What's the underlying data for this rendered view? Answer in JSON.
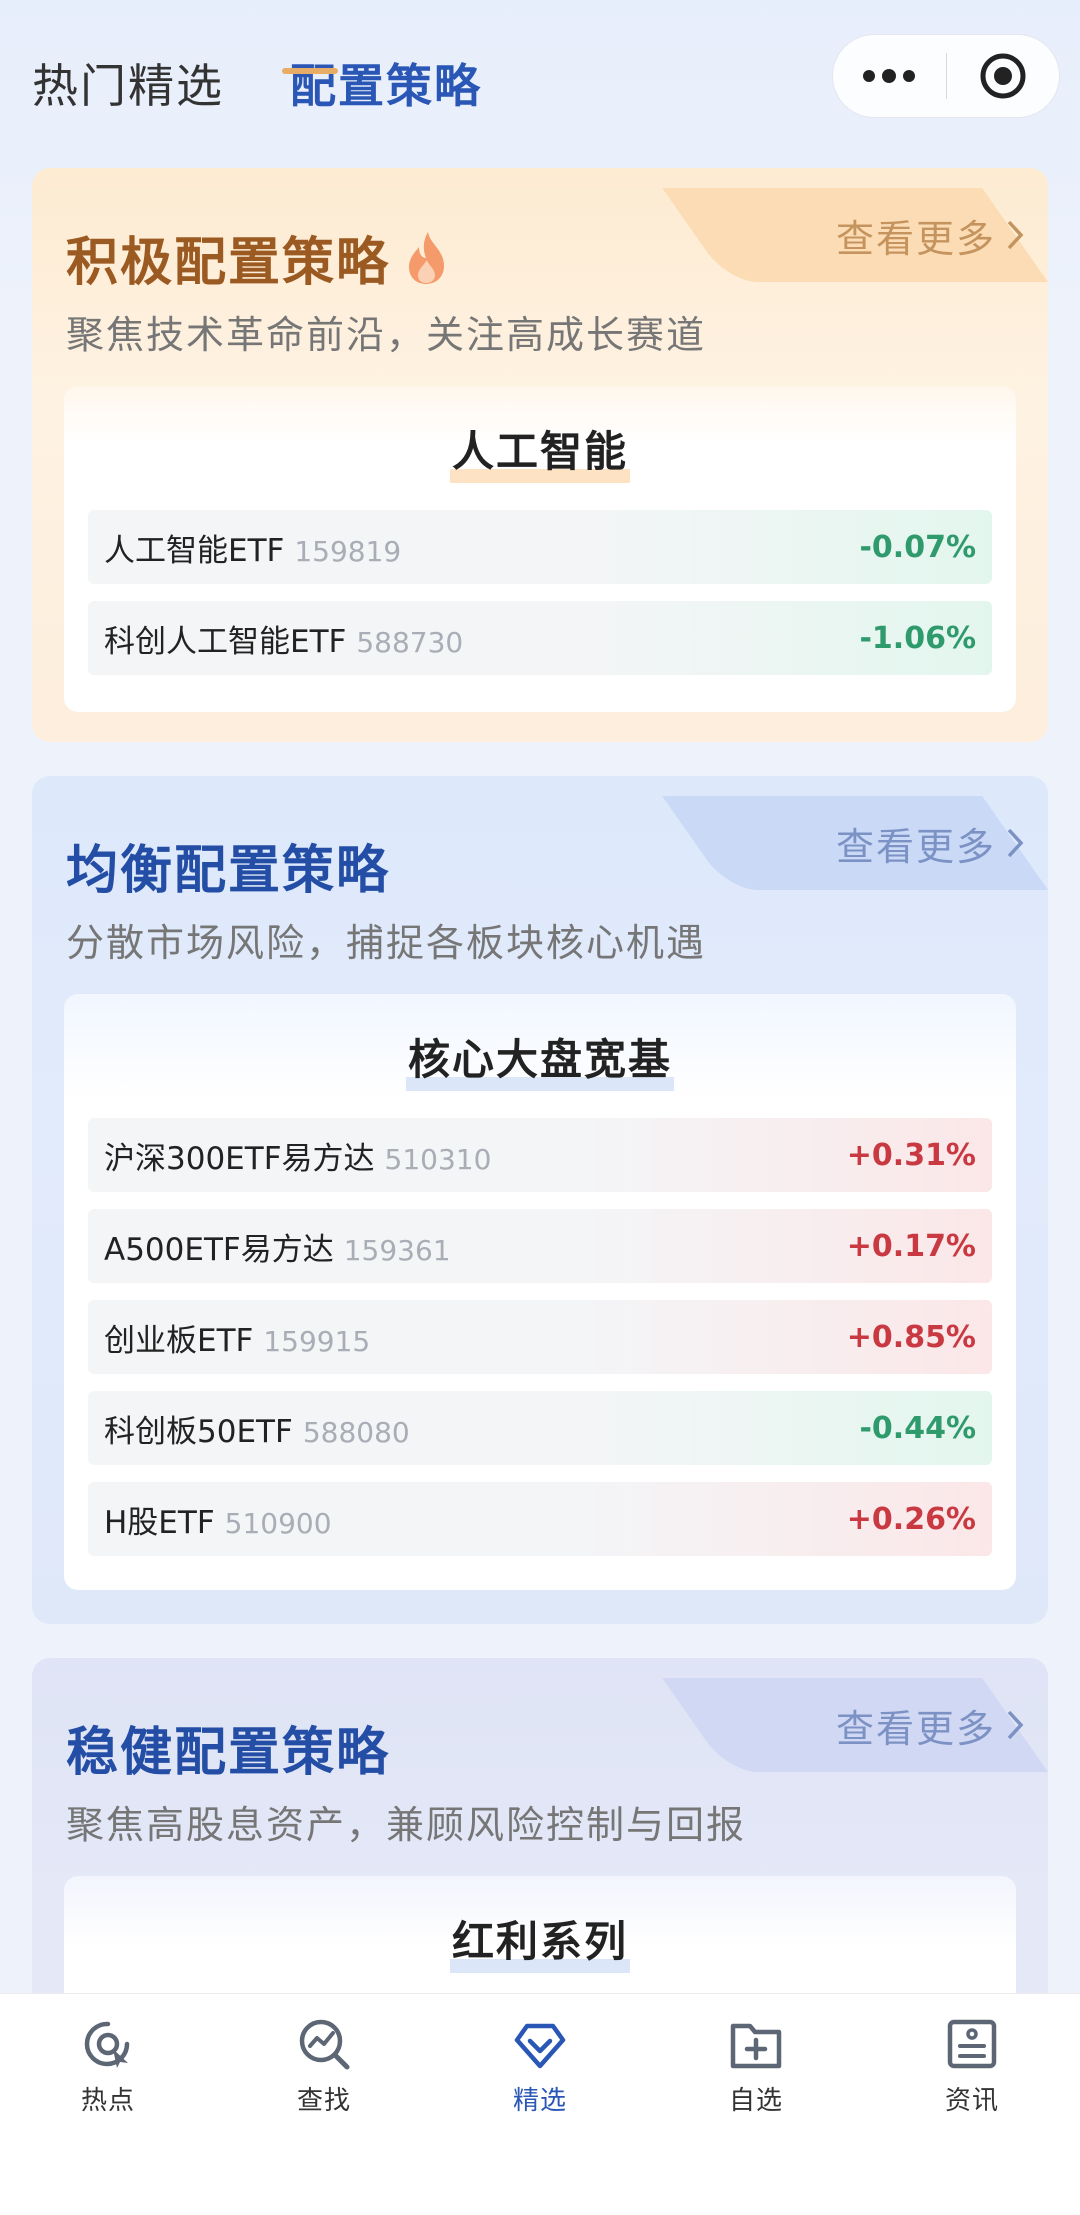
{
  "header": {
    "tabs": [
      {
        "label": "热门精选",
        "active": false
      },
      {
        "label": "配置策略",
        "active": true
      }
    ],
    "capsule": {
      "more_icon": "more-dots-icon",
      "close_icon": "mini-program-close-icon"
    }
  },
  "strategies": [
    {
      "title": "积极配置策略",
      "subtitle": "聚焦技术革命前沿，关注高成长赛道",
      "more_label": "查看更多",
      "title_icon": "fire-icon",
      "group_title": "人工智能",
      "funds": [
        {
          "name": "人工智能ETF",
          "code": "159819",
          "change": "-0.07%",
          "direction": "down"
        },
        {
          "name": "科创人工智能ETF",
          "code": "588730",
          "change": "-1.06%",
          "direction": "down"
        }
      ]
    },
    {
      "title": "均衡配置策略",
      "subtitle": "分散市场风险，捕捉各板块核心机遇",
      "more_label": "查看更多",
      "group_title": "核心大盘宽基",
      "funds": [
        {
          "name": "沪深300ETF易方达",
          "code": "510310",
          "change": "+0.31%",
          "direction": "up"
        },
        {
          "name": "A500ETF易方达",
          "code": "159361",
          "change": "+0.17%",
          "direction": "up"
        },
        {
          "name": "创业板ETF",
          "code": "159915",
          "change": "+0.85%",
          "direction": "up"
        },
        {
          "name": "科创板50ETF",
          "code": "588080",
          "change": "-0.44%",
          "direction": "down"
        },
        {
          "name": "H股ETF",
          "code": "510900",
          "change": "+0.26%",
          "direction": "up"
        }
      ]
    },
    {
      "title": "稳健配置策略",
      "subtitle": "聚焦高股息资产，兼顾风险控制与回报",
      "more_label": "查看更多",
      "group_title": "红利系列",
      "funds": []
    }
  ],
  "tabbar": [
    {
      "label": "热点",
      "icon": "hot-icon",
      "active": false
    },
    {
      "label": "查找",
      "icon": "search-chart-icon",
      "active": false
    },
    {
      "label": "精选",
      "icon": "diamond-heart-icon",
      "active": true
    },
    {
      "label": "自选",
      "icon": "folder-add-icon",
      "active": false
    },
    {
      "label": "资讯",
      "icon": "news-icon",
      "active": false
    }
  ],
  "colors": {
    "accent": "#2a56b5",
    "up": "#c93942",
    "down": "#2f9a6c",
    "warm": "#9b5a22"
  }
}
